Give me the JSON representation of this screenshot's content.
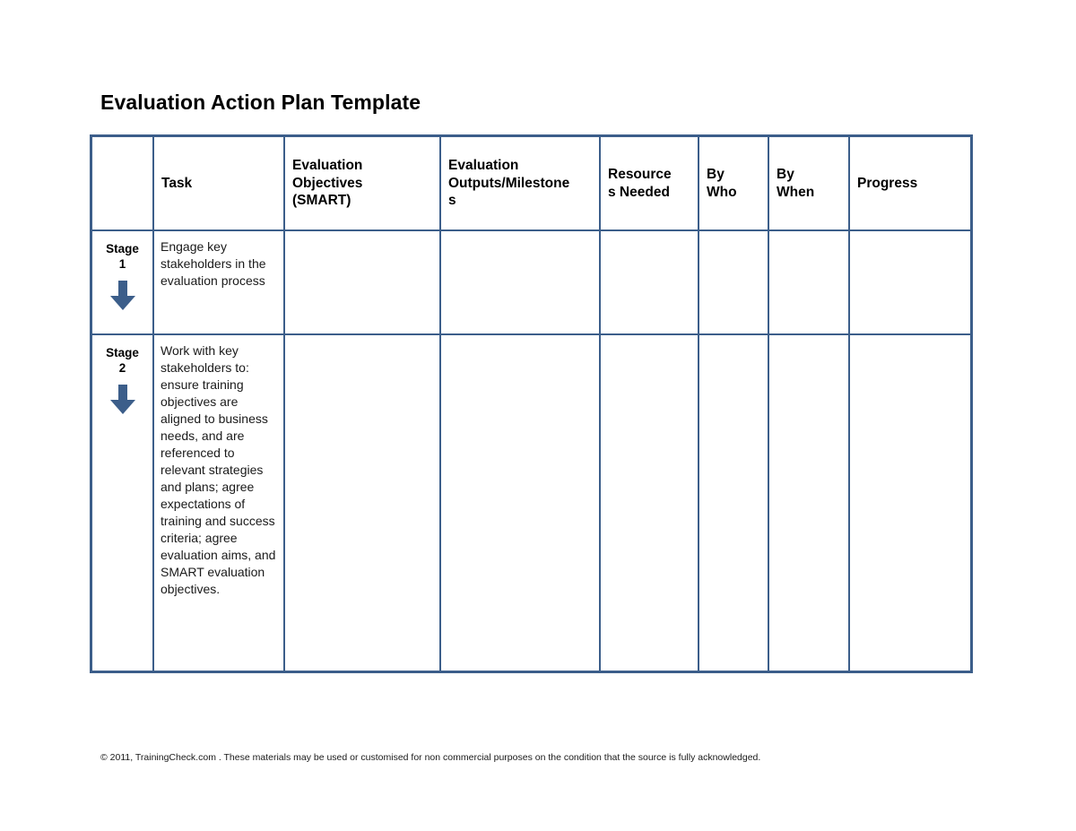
{
  "document": {
    "title": "Evaluation Action Plan Template"
  },
  "table": {
    "columns": [
      {
        "key": "stage",
        "label": "",
        "lines": []
      },
      {
        "key": "task",
        "label": "Task",
        "lines": [
          "Task"
        ]
      },
      {
        "key": "objectives",
        "label": "Evaluation Objectives (SMART)",
        "lines": [
          "Evaluation",
          "Objectives",
          "(SMART)"
        ]
      },
      {
        "key": "outputs",
        "label": "Evaluation Outputs/Milestones",
        "lines": [
          "Evaluation",
          "Outputs/Milestone",
          "s"
        ]
      },
      {
        "key": "resources",
        "label": "Resources Needed",
        "lines": [
          "Resource",
          "s Needed"
        ]
      },
      {
        "key": "by_who",
        "label": "By Who",
        "lines": [
          "By",
          "Who"
        ]
      },
      {
        "key": "by_when",
        "label": "By When",
        "lines": [
          "By",
          "When"
        ]
      },
      {
        "key": "progress",
        "label": "Progress",
        "lines": [
          "Progress"
        ]
      }
    ],
    "rows": [
      {
        "stage_word": "Stage",
        "stage_number": "1",
        "stage_icon": "down-arrow-icon",
        "task": "Engage key stakeholders in the evaluation process",
        "objectives": "",
        "outputs": "",
        "resources": "",
        "by_who": "",
        "by_when": "",
        "progress": ""
      },
      {
        "stage_word": "Stage",
        "stage_number": "2",
        "stage_icon": "down-arrow-icon",
        "task": "Work with key stakeholders to: ensure training objectives are aligned to business needs, and are referenced to relevant strategies and plans;  agree expectations of training and success criteria; agree evaluation aims, and SMART evaluation objectives.",
        "objectives": "",
        "outputs": "",
        "resources": "",
        "by_who": "",
        "by_when": "",
        "progress": ""
      }
    ]
  },
  "footer": {
    "copyright": "© 2011, TrainingCheck.com . These materials may be used or customised for non commercial purposes on the condition that the source is fully acknowledged."
  },
  "colors": {
    "table_border": "#3C5E8A",
    "arrow_fill": "#3C5E8A",
    "page_background": "#FFFFFF",
    "text": "#000000"
  }
}
